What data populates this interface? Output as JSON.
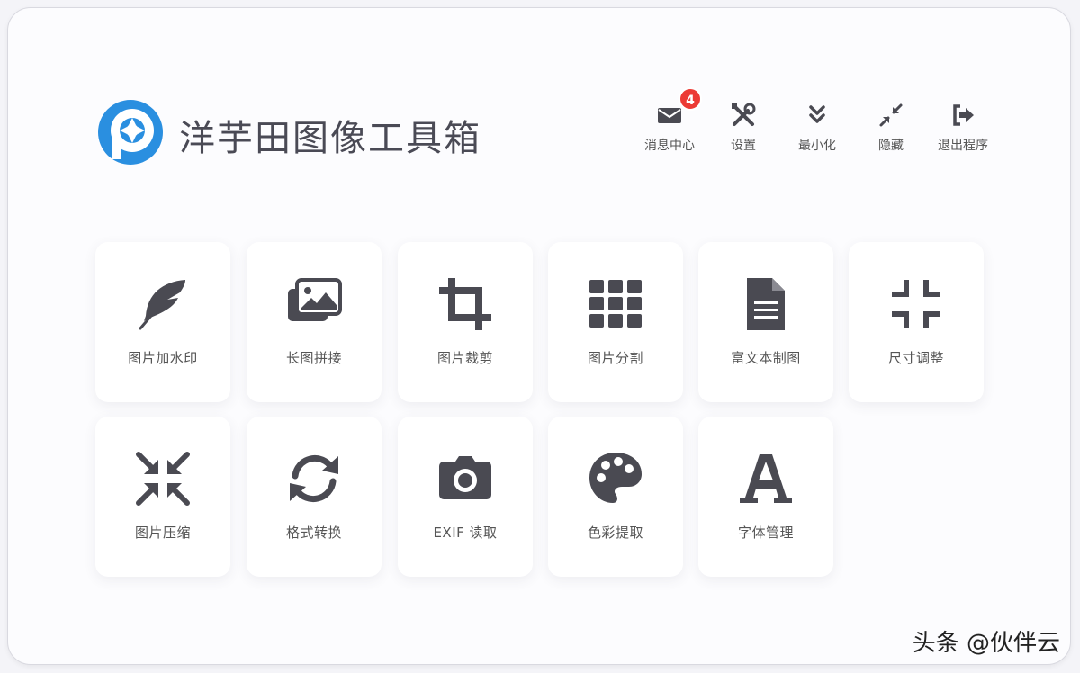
{
  "app": {
    "title": "洋芋田图像工具箱"
  },
  "toolbar": {
    "messages": {
      "label": "消息中心",
      "badge": "4",
      "icon": "mail-icon"
    },
    "settings": {
      "label": "设置",
      "icon": "tools-icon"
    },
    "minimize": {
      "label": "最小化",
      "icon": "chevron-double-down-icon"
    },
    "hide": {
      "label": "隐藏",
      "icon": "compress-arrows-icon"
    },
    "exit": {
      "label": "退出程序",
      "icon": "sign-out-icon"
    }
  },
  "tools": [
    {
      "label": "图片加水印",
      "icon": "feather-icon"
    },
    {
      "label": "长图拼接",
      "icon": "images-icon"
    },
    {
      "label": "图片裁剪",
      "icon": "crop-icon"
    },
    {
      "label": "图片分割",
      "icon": "grid-icon"
    },
    {
      "label": "富文本制图",
      "icon": "document-icon"
    },
    {
      "label": "尺寸调整",
      "icon": "compress-icon"
    },
    {
      "label": "图片压缩",
      "icon": "compress-arrows-icon"
    },
    {
      "label": "格式转换",
      "icon": "sync-icon"
    },
    {
      "label": "EXIF 读取",
      "icon": "camera-icon"
    },
    {
      "label": "色彩提取",
      "icon": "palette-icon"
    },
    {
      "label": "字体管理",
      "icon": "font-icon"
    }
  ],
  "watermark": "头条 @伙伴云",
  "colors": {
    "brand": "#2a8fe0",
    "icon": "#4a4a52",
    "badge": "#ec3a35"
  }
}
